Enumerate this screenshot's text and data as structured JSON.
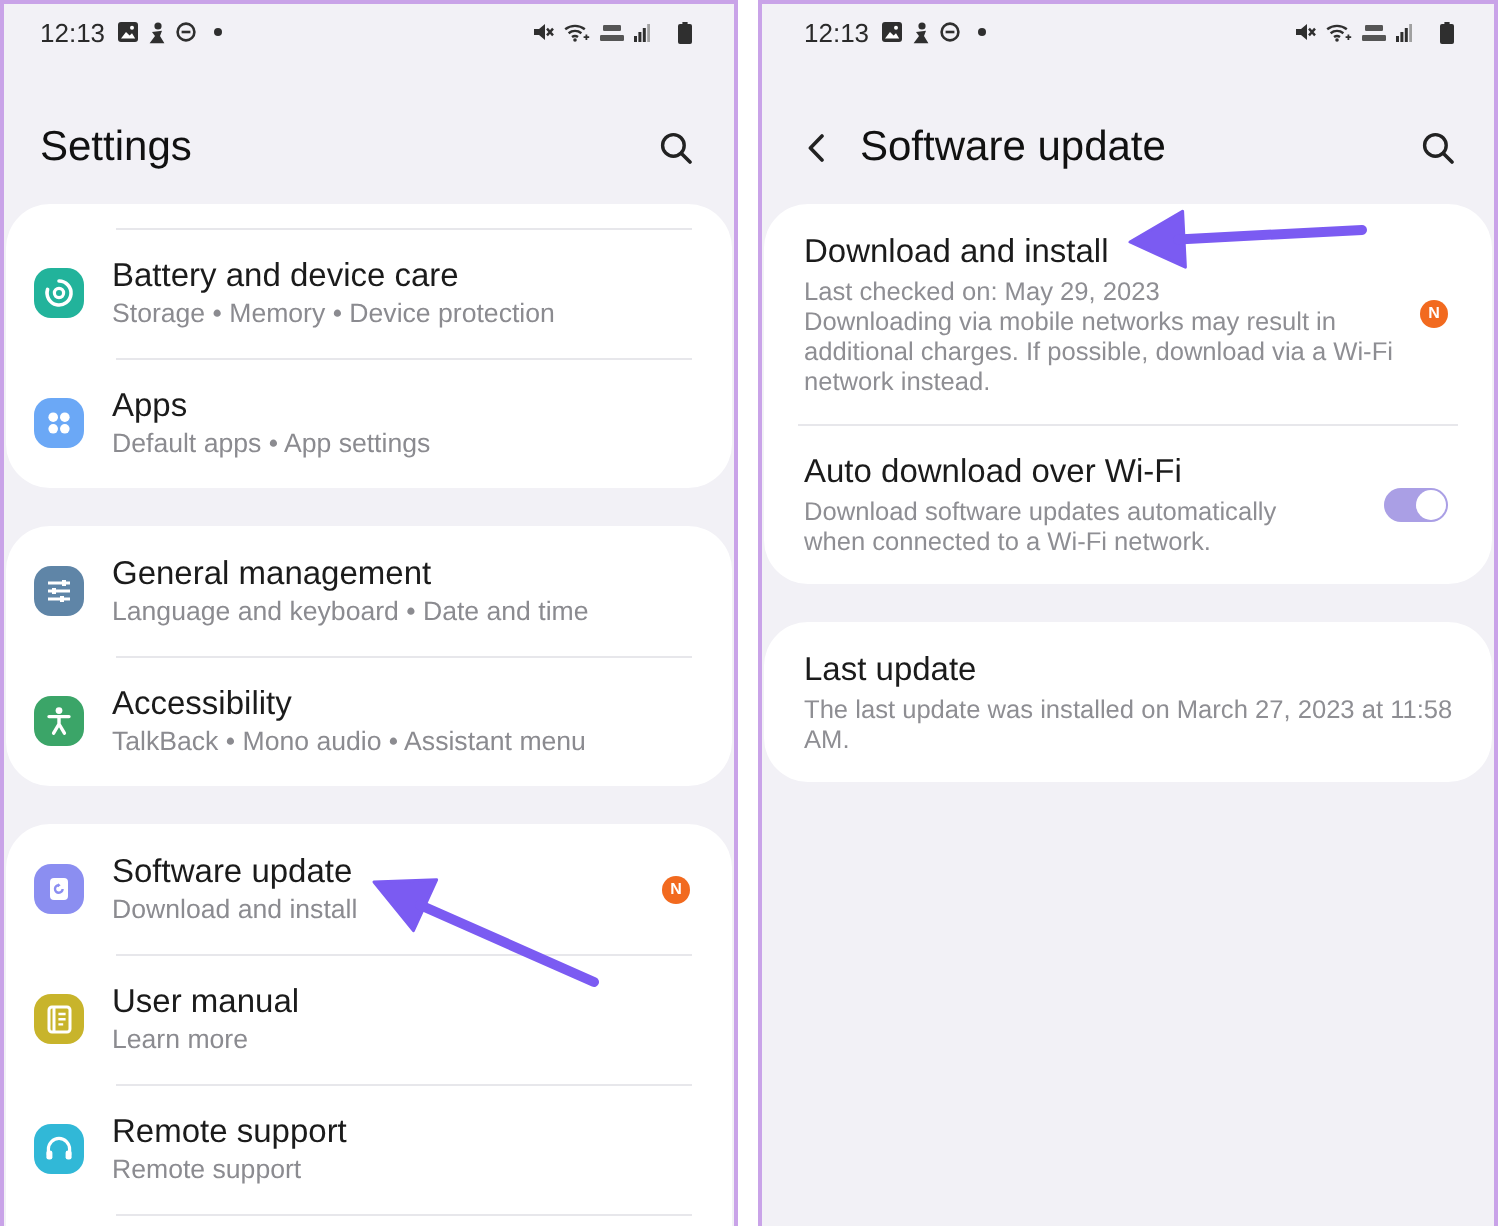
{
  "settings_screen": {
    "status_bar": {
      "time": "12:13"
    },
    "title": "Settings",
    "groups": [
      {
        "clipped_top": true,
        "clipped_bottom": false,
        "items": [
          {
            "title": "Battery and device care",
            "subtitle": "Storage • Memory • Device protection"
          },
          {
            "title": "Apps",
            "subtitle": "Default apps • App settings"
          }
        ]
      },
      {
        "clipped_top": false,
        "clipped_bottom": false,
        "items": [
          {
            "title": "General management",
            "subtitle": "Language and keyboard • Date and time"
          },
          {
            "title": "Accessibility",
            "subtitle": "TalkBack • Mono audio • Assistant menu"
          }
        ]
      },
      {
        "clipped_top": false,
        "clipped_bottom": true,
        "items": [
          {
            "title": "Software update",
            "subtitle": "Download and install",
            "badge": "N"
          },
          {
            "title": "User manual",
            "subtitle": "Learn more"
          },
          {
            "title": "Remote support",
            "subtitle": "Remote support"
          }
        ]
      }
    ]
  },
  "software_update_screen": {
    "status_bar": {
      "time": "12:13"
    },
    "title": "Software update",
    "groups": [
      {
        "items": [
          {
            "kind": "badge",
            "title": "Download and install",
            "lines": [
              "Last checked on: May 29, 2023",
              "Downloading via mobile networks may result in additional charges. If possible, download via a Wi-Fi network instead."
            ],
            "badge": "N"
          },
          {
            "kind": "toggle",
            "title": "Auto download over Wi-Fi",
            "lines": [
              "Download software updates automatically when connected to a Wi-Fi network."
            ],
            "on": true
          }
        ]
      },
      {
        "items": [
          {
            "kind": "plain",
            "title": "Last update",
            "lines": [
              "The last update was installed on March 27, 2023 at 11:58 AM."
            ]
          }
        ]
      }
    ]
  }
}
